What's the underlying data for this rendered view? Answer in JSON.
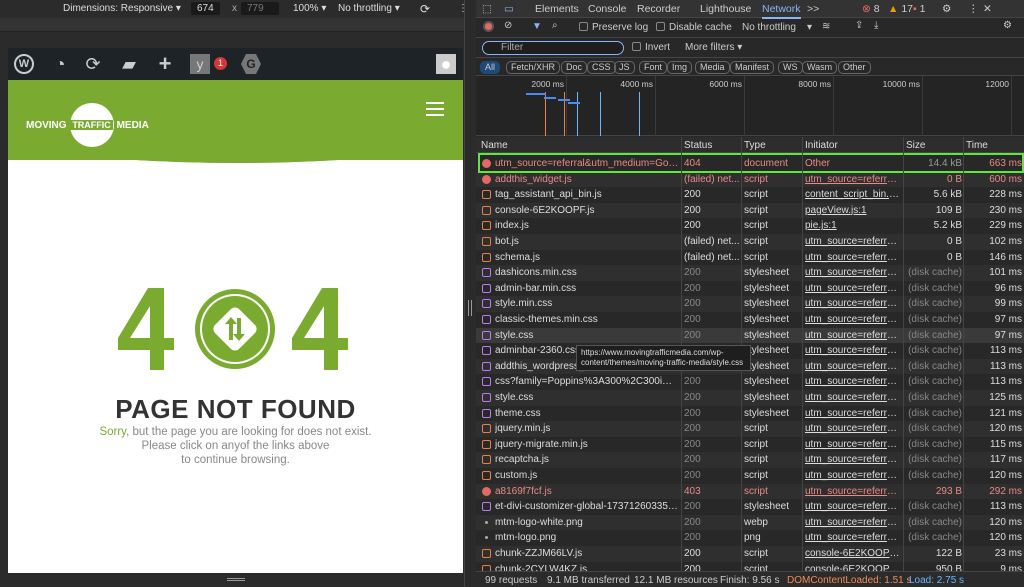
{
  "device_toolbar": {
    "dimensions": "Dimensions: Responsive ▾",
    "width": "674",
    "x": "x",
    "height": "779",
    "zoom": "100% ▾",
    "throttling": "No throttling ▾"
  },
  "wp_admin_bar": {
    "notification_count": "1",
    "icons": [
      "wordpress-icon",
      "dashboard-icon",
      "updates-icon",
      "comments-icon",
      "plus-icon",
      "yoast-icon",
      "gravity-forms-icon",
      "avatar-icon"
    ]
  },
  "site": {
    "logo_left": "MOVING",
    "logo_mid": "TRAFFIC",
    "logo_right": "MEDIA",
    "brand_color": "#7aab30",
    "error_code": "404",
    "title": "PAGE NOT FOUND",
    "sorry": "Sorry",
    "msg1": ", but the page you are looking for does not exist.",
    "msg2": "Please click on anyof the links above",
    "msg3": "to continue browsing."
  },
  "devtools": {
    "tabs": [
      "Elements",
      "Console",
      "Recorder",
      "Lighthouse",
      "Network",
      ">>"
    ],
    "active_tab": "Network",
    "errors": "8",
    "warnings": "17",
    "issues": "1",
    "preserve_log": "Preserve log",
    "disable_cache": "Disable cache",
    "throttling": "No throttling",
    "filter_placeholder": "Filter",
    "invert": "Invert",
    "more_filters": "More filters ▾",
    "type_filters": [
      "All",
      "Fetch/XHR",
      "Doc",
      "CSS",
      "JS",
      "Font",
      "Img",
      "Media",
      "Manifest",
      "WS",
      "Wasm",
      "Other"
    ],
    "timeline_ticks": [
      "2000 ms",
      "4000 ms",
      "6000 ms",
      "8000 ms",
      "10000 ms",
      "12000"
    ],
    "columns": [
      "Name",
      "Status",
      "Type",
      "Initiator",
      "Size",
      "Time"
    ],
    "rows": [
      [
        "err",
        "utm_source=referral&utm_medium=Goo...",
        "404",
        "document",
        "Other",
        "14.4 kB",
        "663 ms",
        "error"
      ],
      [
        "err",
        "addthis_widget.js",
        "(failed) net...",
        "script",
        "utm_source=referral&u",
        "0 B",
        "600 ms",
        "error"
      ],
      [
        "js",
        "tag_assistant_api_bin.js",
        "200",
        "script",
        "content_script_bin.js:8",
        "5.6 kB",
        "228 ms",
        ""
      ],
      [
        "js",
        "console-6E2KOOPF.js",
        "200",
        "script",
        "pageView.js:1",
        "109 B",
        "230 ms",
        ""
      ],
      [
        "js",
        "index.js",
        "200",
        "script",
        "pie.js:1",
        "5.2 kB",
        "229 ms",
        ""
      ],
      [
        "js",
        "bot.js",
        "(failed) net...",
        "script",
        "utm_source=referral&u",
        "0 B",
        "102 ms",
        ""
      ],
      [
        "js",
        "schema.js",
        "(failed) net...",
        "script",
        "utm_source=referral&u",
        "0 B",
        "146 ms",
        ""
      ],
      [
        "css",
        "dashicons.min.css",
        "200",
        "stylesheet",
        "utm_source=referral&u",
        "(disk cache)",
        "101 ms",
        "cached"
      ],
      [
        "css",
        "admin-bar.min.css",
        "200",
        "stylesheet",
        "utm_source=referral&u",
        "(disk cache)",
        "96 ms",
        "cached"
      ],
      [
        "css",
        "style.min.css",
        "200",
        "stylesheet",
        "utm_source=referral&u",
        "(disk cache)",
        "99 ms",
        "cached"
      ],
      [
        "css",
        "classic-themes.min.css",
        "200",
        "stylesheet",
        "utm_source=referral&u",
        "(disk cache)",
        "97 ms",
        "cached"
      ],
      [
        "css",
        "style.css",
        "200",
        "stylesheet",
        "utm_source=referral&u",
        "(disk cache)",
        "97 ms",
        "cached"
      ],
      [
        "css",
        "adminbar-2360.css",
        "200",
        "stylesheet",
        "utm_source=referral&u",
        "(disk cache)",
        "113 ms",
        "cached"
      ],
      [
        "css",
        "addthis_wordpress_public.min.css",
        "200",
        "stylesheet",
        "utm_source=referral&u",
        "(disk cache)",
        "113 ms",
        "cached"
      ],
      [
        "css",
        "css?family=Poppins%3A300%2C300i%2...",
        "200",
        "stylesheet",
        "utm_source=referral&u",
        "(disk cache)",
        "113 ms",
        "cached"
      ],
      [
        "css",
        "style.css",
        "200",
        "stylesheet",
        "utm_source=referral&u",
        "(disk cache)",
        "125 ms",
        "cached"
      ],
      [
        "css",
        "theme.css",
        "200",
        "stylesheet",
        "utm_source=referral&u",
        "(disk cache)",
        "121 ms",
        "cached"
      ],
      [
        "js",
        "jquery.min.js",
        "200",
        "script",
        "utm_source=referral&u",
        "(disk cache)",
        "120 ms",
        "cached"
      ],
      [
        "js",
        "jquery-migrate.min.js",
        "200",
        "script",
        "utm_source=referral&u",
        "(disk cache)",
        "115 ms",
        "cached"
      ],
      [
        "js",
        "recaptcha.js",
        "200",
        "script",
        "utm_source=referral&u",
        "(disk cache)",
        "117 ms",
        "cached"
      ],
      [
        "js",
        "custom.js",
        "200",
        "script",
        "utm_source=referral&u",
        "(disk cache)",
        "120 ms",
        "cached"
      ],
      [
        "err",
        "a8169f7fcf.js",
        "403",
        "script",
        "utm_source=referral&u",
        "293 B",
        "292 ms",
        "error"
      ],
      [
        "css",
        "et-divi-customizer-global-173712603357...",
        "200",
        "stylesheet",
        "utm_source=referral&u",
        "(disk cache)",
        "113 ms",
        "cached"
      ],
      [
        "img",
        "mtm-logo-white.png",
        "200",
        "webp",
        "utm_source=referral&u",
        "(disk cache)",
        "120 ms",
        "cached"
      ],
      [
        "img",
        "mtm-logo.png",
        "200",
        "png",
        "utm_source=referral&u",
        "(disk cache)",
        "120 ms",
        "cached"
      ],
      [
        "js",
        "chunk-ZZJM66LV.js",
        "200",
        "script",
        "console-6E2KOOPF.js:1",
        "122 B",
        "23 ms",
        ""
      ],
      [
        "js",
        "chunk-2CYLW4KZ.js",
        "200",
        "script",
        "console-6E2KOOPF.js:1",
        "950 B",
        "9 ms",
        ""
      ]
    ],
    "tooltip": "https://www.movingtrafficmedia.com/wp-content/themes/moving-traffic-media/style.css",
    "status": {
      "requests": "99 requests",
      "transferred": "9.1 MB transferred",
      "resources": "12.1 MB resources",
      "finish": "Finish: 9.56 s",
      "dcl": "DOMContentLoaded: 1.51 s",
      "load": "Load: 2.75 s"
    }
  }
}
